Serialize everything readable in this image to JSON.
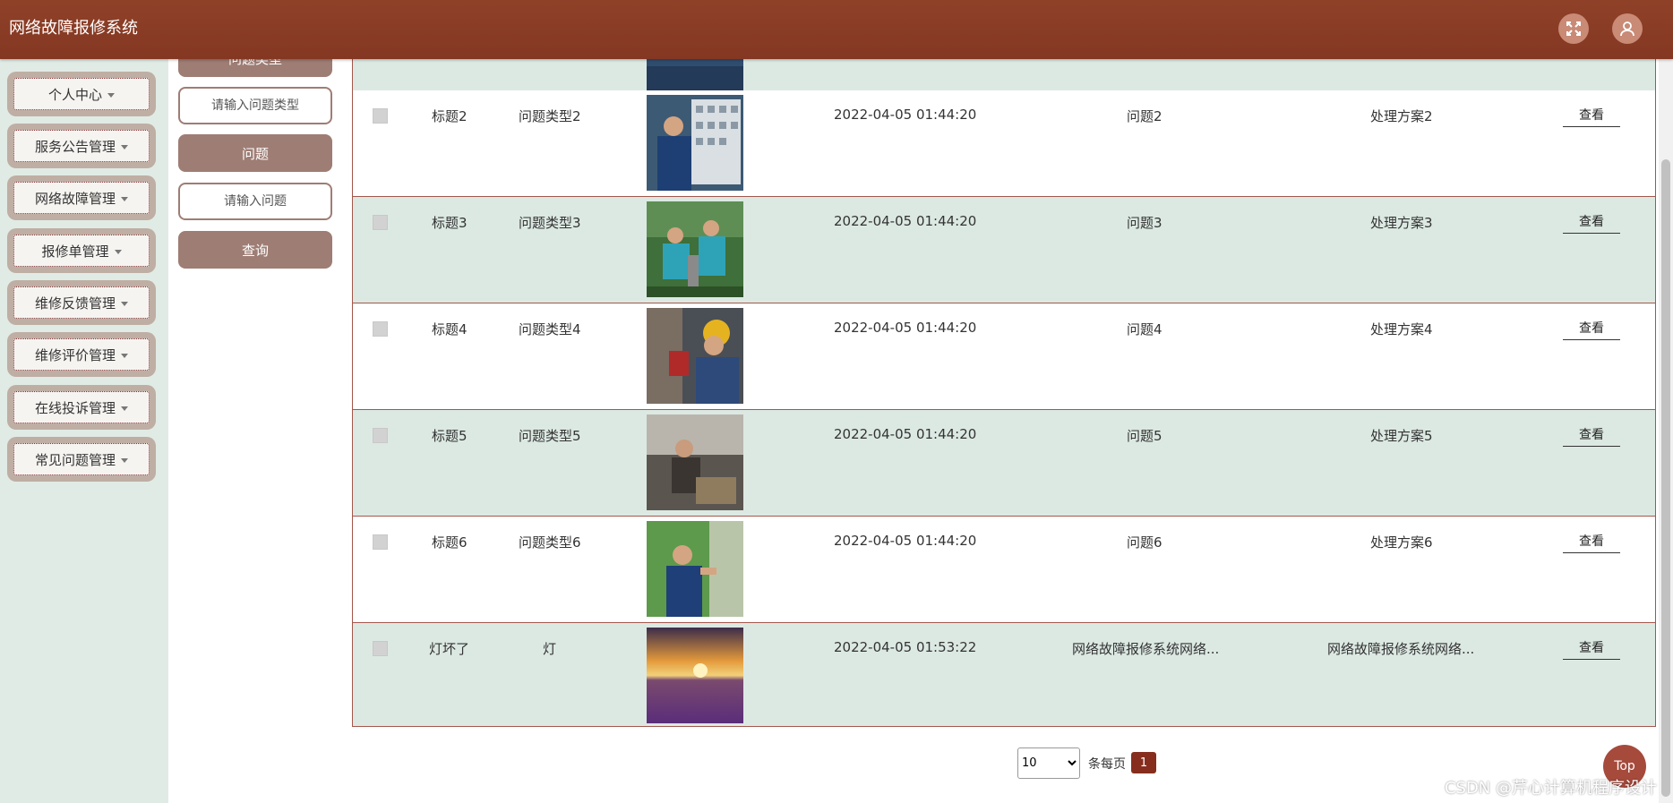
{
  "header": {
    "title": "网络故障报修系统"
  },
  "sidebar": {
    "items": [
      {
        "label": "个人中心"
      },
      {
        "label": "服务公告管理"
      },
      {
        "label": "网络故障管理"
      },
      {
        "label": "报修单管理"
      },
      {
        "label": "维修反馈管理"
      },
      {
        "label": "维修评价管理"
      },
      {
        "label": "在线投诉管理"
      },
      {
        "label": "常见问题管理"
      }
    ]
  },
  "search": {
    "type_label": "问题类型",
    "type_placeholder": "请输入问题类型",
    "question_label": "问题",
    "question_placeholder": "请输入问题",
    "query_button": "查询"
  },
  "table": {
    "rows": [
      {
        "title": "标题2",
        "type": "问题类型2",
        "time": "2022-04-05 01:44:20",
        "question": "问题2",
        "solution": "处理方案2",
        "action": "查看"
      },
      {
        "title": "标题3",
        "type": "问题类型3",
        "time": "2022-04-05 01:44:20",
        "question": "问题3",
        "solution": "处理方案3",
        "action": "查看"
      },
      {
        "title": "标题4",
        "type": "问题类型4",
        "time": "2022-04-05 01:44:20",
        "question": "问题4",
        "solution": "处理方案4",
        "action": "查看"
      },
      {
        "title": "标题5",
        "type": "问题类型5",
        "time": "2022-04-05 01:44:20",
        "question": "问题5",
        "solution": "处理方案5",
        "action": "查看"
      },
      {
        "title": "标题6",
        "type": "问题类型6",
        "time": "2022-04-05 01:44:20",
        "question": "问题6",
        "solution": "处理方案6",
        "action": "查看"
      },
      {
        "title": "灯坏了",
        "type": "灯",
        "time": "2022-04-05 01:53:22",
        "question": "网络故障报修系统网络...",
        "solution": "网络故障报修系统网络...",
        "action": "查看"
      }
    ]
  },
  "pagination": {
    "page_size": "10",
    "per_page_label": "条每页",
    "current_page": "1"
  },
  "top_button": "Top",
  "watermark": "CSDN @芹心计算机程序设计",
  "icons": {
    "fullscreen": "fullscreen-icon",
    "user": "user-icon"
  },
  "colors": {
    "header": "#8a3c25",
    "accent": "#862d1d",
    "row_alt": "#dce9e3",
    "button": "#9e7d74"
  }
}
